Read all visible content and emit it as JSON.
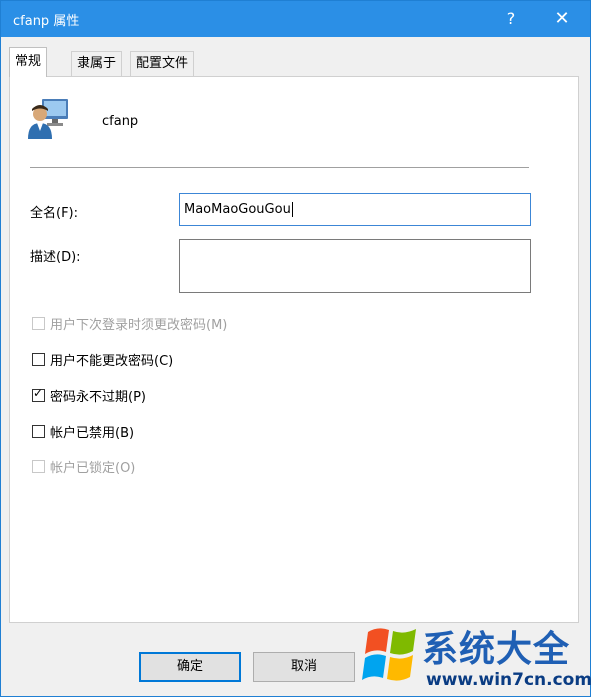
{
  "window": {
    "title": "cfanp 属性",
    "help": "?",
    "close": "✕"
  },
  "tabs": [
    {
      "label": "常规",
      "active": true
    },
    {
      "label": "隶属于",
      "active": false
    },
    {
      "label": "配置文件",
      "active": false
    }
  ],
  "user": {
    "name": "cfanp",
    "icon": "user-monitor-icon"
  },
  "fullname": {
    "label": "全名(F):",
    "value": "MaoMaoGouGou"
  },
  "description": {
    "label": "描述(D):",
    "value": ""
  },
  "options": [
    {
      "label": "用户下次登录时须更改密码(M)",
      "checked": false,
      "enabled": false
    },
    {
      "label": "用户不能更改密码(C)",
      "checked": false,
      "enabled": true
    },
    {
      "label": "密码永不过期(P)",
      "checked": true,
      "enabled": true
    },
    {
      "label": "帐户已禁用(B)",
      "checked": false,
      "enabled": true
    },
    {
      "label": "帐户已锁定(O)",
      "checked": false,
      "enabled": false
    }
  ],
  "buttons": {
    "ok": "确定",
    "cancel": "取消"
  },
  "watermark": {
    "title": "系统大全",
    "url": "www.win7cn.com"
  },
  "colors": {
    "titlebar": "#2b8fe6",
    "focus_border": "#3c86d6",
    "default_button_border": "#0078d7"
  }
}
